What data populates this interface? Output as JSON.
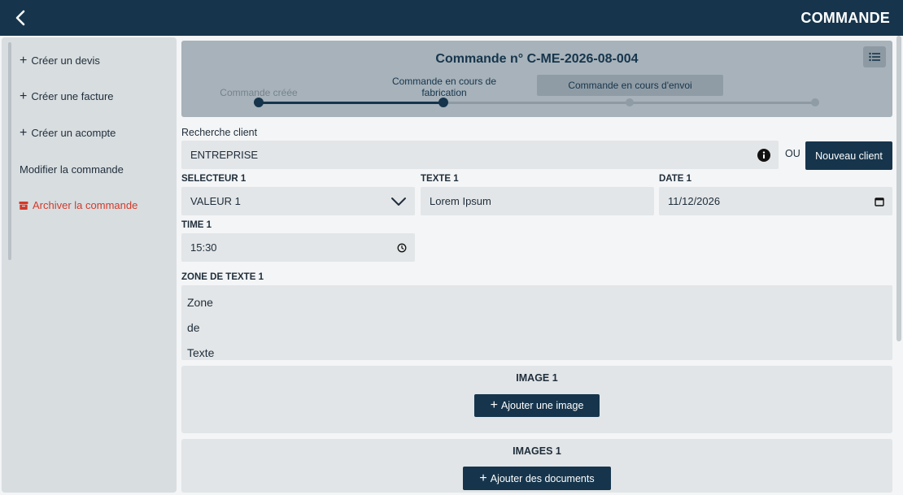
{
  "header": {
    "title": "COMMANDE"
  },
  "sidebar": {
    "items": [
      {
        "label": "Créer un devis",
        "icon": "plus"
      },
      {
        "label": "Créer une facture",
        "icon": "plus"
      },
      {
        "label": "Créer un acompte",
        "icon": "plus"
      },
      {
        "label": "Modifier la commande",
        "icon": ""
      },
      {
        "label": "Archiver la commande",
        "icon": "archive-icon"
      }
    ]
  },
  "order": {
    "title": "Commande n° C-ME-2026-08-004",
    "steps": [
      {
        "label": "Commande créée",
        "state": "done"
      },
      {
        "label": "Commande en cours de fabrication",
        "state": "current"
      },
      {
        "label": "Commande en cours d'envoi",
        "state": "upcoming"
      },
      {
        "label": "",
        "state": "upcoming"
      }
    ]
  },
  "client": {
    "label": "Recherche client",
    "value": "ENTREPRISE",
    "or_text": "OU",
    "new_button": "Nouveau client"
  },
  "form": {
    "selecteur": {
      "label": "SELECTEUR 1",
      "value": "VALEUR 1"
    },
    "texte": {
      "label": "TEXTE 1",
      "value": "Lorem Ipsum"
    },
    "date": {
      "label": "DATE 1",
      "value": "11/12/2026"
    },
    "time": {
      "label": "TIME 1",
      "value": "15:30"
    },
    "zone": {
      "label": "ZONE DE TEXTE 1",
      "lines": [
        "Zone",
        "de",
        "Texte"
      ]
    }
  },
  "image_panel": {
    "title": "IMAGE 1",
    "button": "Ajouter une image"
  },
  "images_panel": {
    "title": "IMAGES 1",
    "button": "Ajouter des documents"
  },
  "colors": {
    "primary": "#16354c",
    "danger": "#d23a2a",
    "header_bg": "#a7b2ba"
  }
}
